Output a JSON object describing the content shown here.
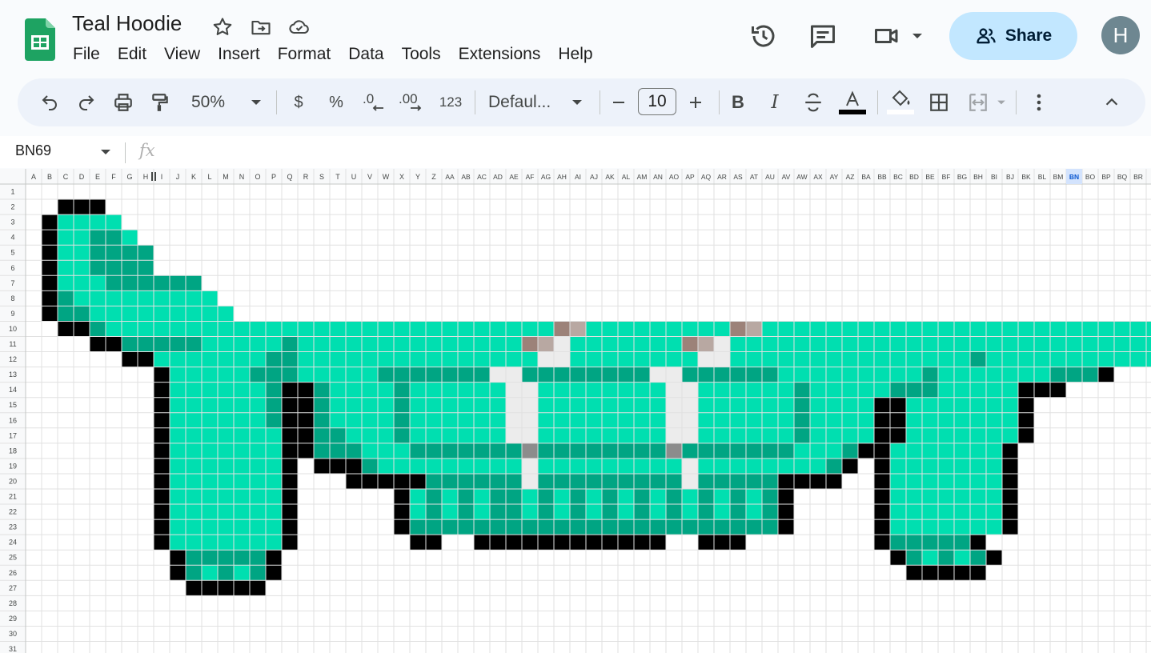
{
  "app": {
    "doc_title": "Teal Hoodie",
    "menu": [
      "File",
      "Edit",
      "View",
      "Insert",
      "Format",
      "Data",
      "Tools",
      "Extensions",
      "Help"
    ],
    "share_label": "Share",
    "avatar_letter": "H"
  },
  "toolbar": {
    "zoom": "50%",
    "currency": "$",
    "percent": "%",
    "number_format": "123",
    "font": "Defaul...",
    "font_size": "10",
    "bold": "B",
    "italic": "I"
  },
  "formula_bar": {
    "name_box": "BN69",
    "fx": "fx"
  },
  "sheet": {
    "columns": [
      "A",
      "B",
      "C",
      "D",
      "E",
      "F",
      "G",
      "H",
      "I",
      "J",
      "K",
      "L",
      "M",
      "N",
      "O",
      "P",
      "Q",
      "R",
      "S",
      "T",
      "U",
      "V",
      "W",
      "X",
      "Y",
      "Z",
      "AA",
      "AB",
      "AC",
      "AD",
      "AE",
      "AF",
      "AG",
      "AH",
      "AI",
      "AJ",
      "AK",
      "AL",
      "AM",
      "AN",
      "AO",
      "AP",
      "AQ",
      "AR",
      "AS",
      "AT",
      "AU",
      "AV",
      "AW",
      "AX",
      "AY",
      "AZ",
      "BA",
      "BB",
      "BC",
      "BD",
      "BE",
      "BF",
      "BG",
      "BH",
      "BI",
      "BJ",
      "BK",
      "BL",
      "BM",
      "BN",
      "BO",
      "BP",
      "BQ",
      "BR"
    ],
    "selected_column": "BN",
    "row_count": 31,
    "palette": {
      "K": "#000000",
      "T": "#00dfb0",
      "D": "#00a583",
      "W": "#ececec",
      "S": "#b8a8a2",
      "Z": "#9c8279",
      "G": "#8c8c8c"
    },
    "pixels": [
      "",
      "..KKK",
      ".KTTTT",
      ".KTTDDT",
      ".KTTDDDD",
      ".KTTDDDD",
      ".KTTTDDDDDD",
      ".KDTTTTTTTTT",
      ".KDDTTTTTTTTT",
      "..KKDTTTTTTTTTTTTTTTTTTTTTTTTTTTTZSTTTTTTTTTZSTTTTTTTTTTTTTTTTTTTTTTTTTTTTTTTTTTTTTTTTTTTTTTDDK",
      "....KKDDDDDTTTTTDTTTTTTTTTTTTTTZSWTTTTTTTZSWTTTTTTTTTTTTTTTTTTTTTTTTTTTTTTTTTTTTTTTTTTTTTTTTTTDK",
      "......KKTTTTTTTDDTTTTTTTTTTTTTTTWWTTTTTTTTWWTTTTTTTTTTTTTTTDTTTTTTTTTTTK",
      "........KTTTTTDDDTTTTTDDDDDDDWWDDDDDDDDWWDDDDDDTTTTTTTTTDTTTTTTTDDDK",
      "........KTTTTTTDKKDTTTTDTTTTTTWWTTTTTTTTWWTTTTTTDTTTTTDDDTTTTTKKK",
      "........KTTTTTTDKKDTTTTDTTTTTTWWTTTTTTTTWWTTTTTTDTTTTKKTTTTTTTK",
      "........KTTTTTTDKKDTTTTDTTTTTTWWTTTTTTTTWWTTTTTTDTTTTKKTTTTTTTK",
      "........KTTTTTTTKKDDTTTDTTTTTTWWTTTTTTTTWWTTTTTTDTTTTKKTTTTTTTK",
      "........KTTTTTTTKKDDDTTTDDDDDDDGDDDDDDDDGDDDDDDDTTTDKKTTTTTTTK",
      "........KTTTTTTTK.KKKDTTTTTTTTTWTTTTTTTTTWTTTTTTTTDK.KTTTTTTTK",
      "........KTTTTTTTK...KKKKKDDDDDDWDDDDDDDDDWDDDDDKKKK..KTTTTTTTK",
      "........KTTTTTTTK......KTDTDTDDTDTDTDTDTDTDTDTDK.....KTTTTTTTK",
      "........KTTTTTTTK......KTDTDTDDTDTDTDTDTDTDTDTDK.....KTTTTTTTK",
      "........KTTTTTTTK......KDDDDDDDDDDDDDDDDDDDDDDDK.....KTTTTTTTK",
      "........KTTTTTTTK.......KK..KKKKKKKKKKKK..KKK........KDDDDDK",
      ".........KDDDDDK......................................KDTDTDK",
      ".........KDTDTDK.......................................KKKKK",
      "..........KKKKK"
    ]
  }
}
